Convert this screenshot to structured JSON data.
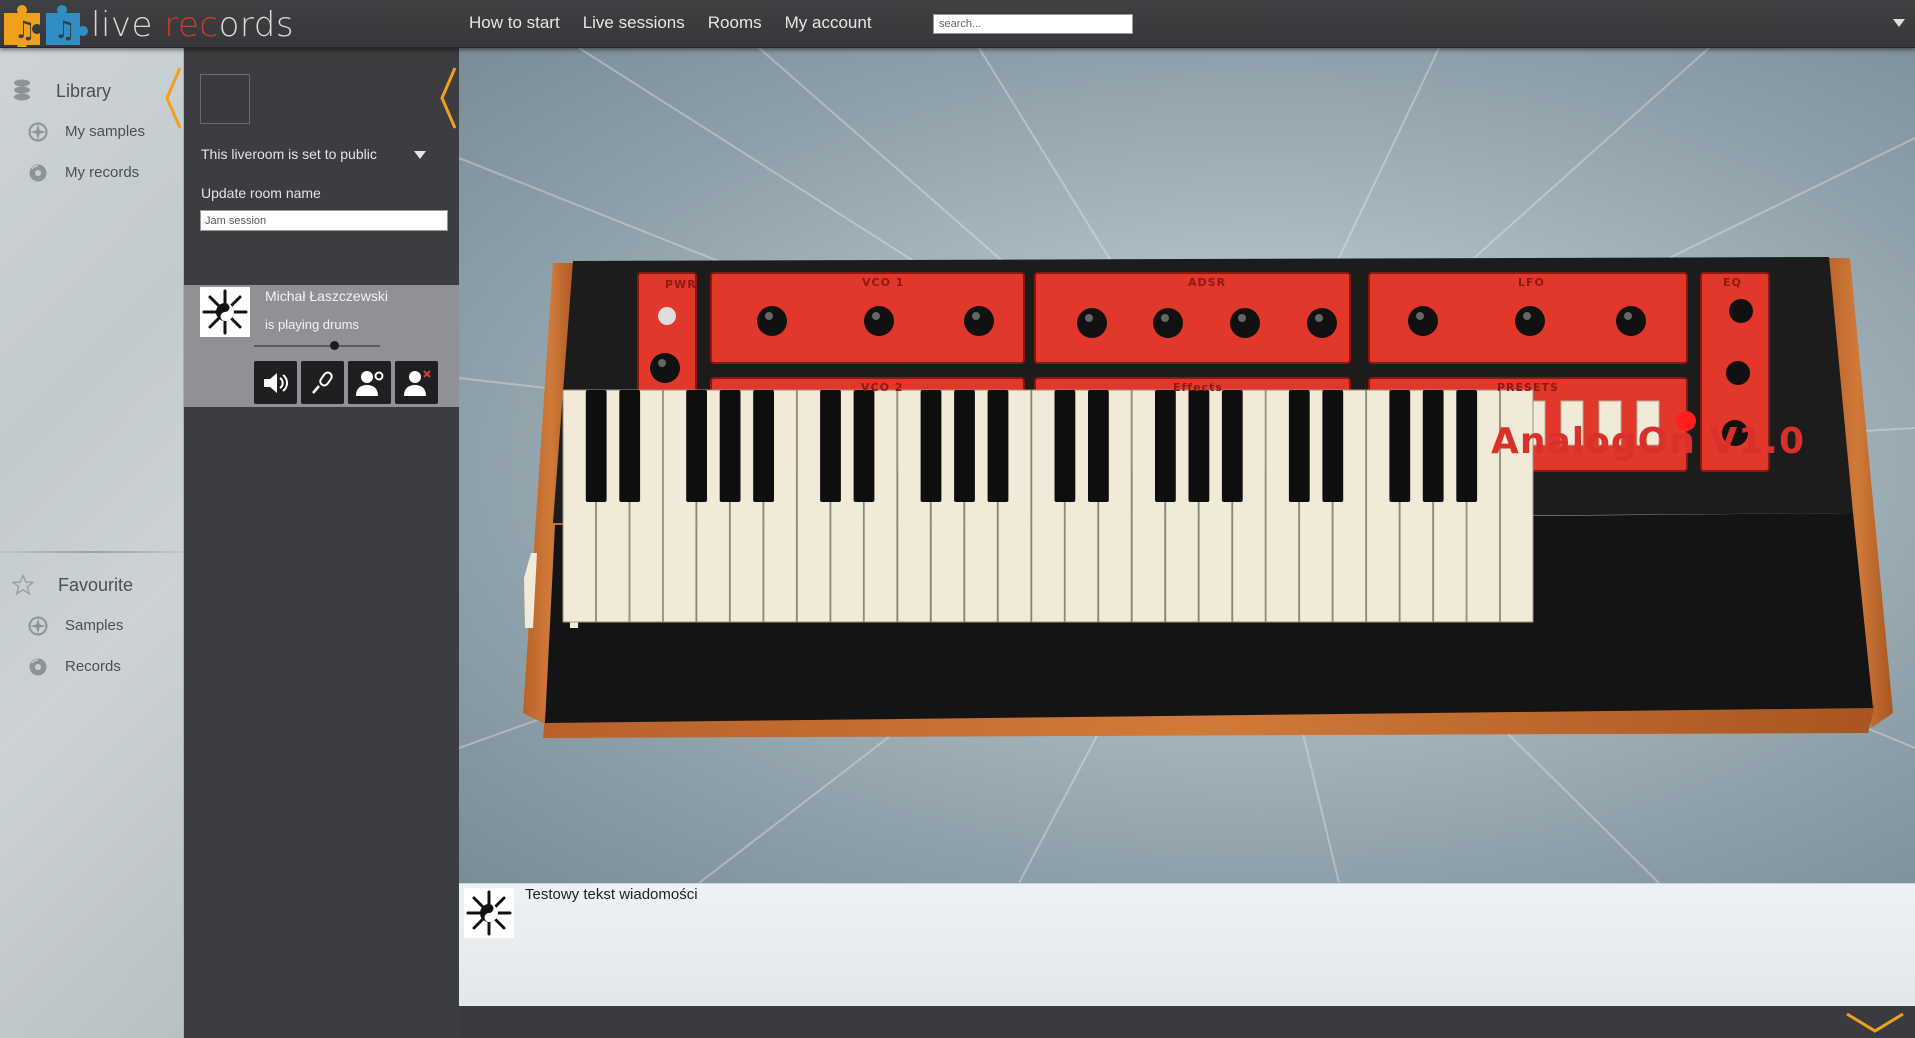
{
  "app": {
    "logo_text_pre": "live ",
    "logo_text_red": "rec",
    "logo_text_post": "ords",
    "accent_red": "#d13a2c",
    "accent_orange": "#f0a11c"
  },
  "nav": {
    "items": [
      "How to start",
      "Live sessions",
      "Rooms",
      "My account"
    ],
    "search_placeholder": "search..."
  },
  "sidebar": {
    "library": {
      "title": "Library",
      "icon": "library-stack-icon",
      "items": [
        {
          "label": "My samples",
          "icon": "samples-icon"
        },
        {
          "label": "My records",
          "icon": "records-icon"
        }
      ]
    },
    "favourite": {
      "title": "Favourite",
      "icon": "star-icon",
      "items": [
        {
          "label": "Samples",
          "icon": "samples-icon"
        },
        {
          "label": "Records",
          "icon": "records-icon"
        }
      ]
    }
  },
  "room": {
    "privacy_text": "This liveroom is set to public",
    "name_label": "Update room name",
    "name_value": "Jam session",
    "users": [
      {
        "name": "Michał Łaszczewski",
        "status": "is playing drums",
        "volume": 0.65,
        "actions": [
          "volume-icon",
          "microphone-icon",
          "user-settings-icon",
          "remove-user-icon"
        ]
      }
    ]
  },
  "synth": {
    "brand": "AnalogOn V1.0",
    "sections": [
      "PWR",
      "VCO 1",
      "ADSR",
      "LFO",
      "EQ",
      "VCO 2",
      "Effects",
      "PRESETS"
    ],
    "presets_count": 7
  },
  "chat": {
    "messages": [
      {
        "text": "Testowy tekst wiadomości"
      }
    ]
  }
}
